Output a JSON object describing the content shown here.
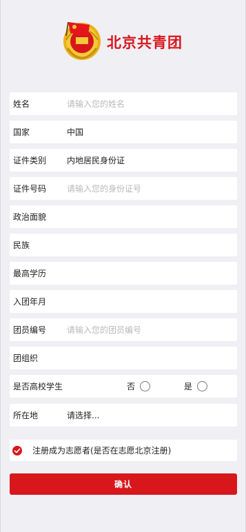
{
  "brand": {
    "title": "北京共青团"
  },
  "fields": [
    {
      "label": "姓名",
      "value": "",
      "placeholder": "请输入您的姓名"
    },
    {
      "label": "国家",
      "value": "中国",
      "placeholder": ""
    },
    {
      "label": "证件类别",
      "value": "内地居民身份证",
      "placeholder": ""
    },
    {
      "label": "证件号码",
      "value": "",
      "placeholder": "请输入您的身份证号"
    },
    {
      "label": "政治面貌",
      "value": "",
      "placeholder": ""
    },
    {
      "label": "民族",
      "value": "",
      "placeholder": ""
    },
    {
      "label": "最高学历",
      "value": "",
      "placeholder": ""
    },
    {
      "label": "入团年月",
      "value": "",
      "placeholder": ""
    },
    {
      "label": "团员编号",
      "value": "",
      "placeholder": "请输入您的团员编号"
    },
    {
      "label": "团组织",
      "value": "",
      "placeholder": ""
    }
  ],
  "student": {
    "label": "是否高校学生",
    "no_label": "否",
    "yes_label": "是"
  },
  "location": {
    "label": "所在地",
    "value": "请选择..."
  },
  "volunteer": {
    "label": "注册成为志愿者(是否在志愿北京注册)",
    "checked": true
  },
  "confirm": {
    "label": "确认"
  },
  "colors": {
    "accent": "#d7171c",
    "background": "#efeff4"
  }
}
